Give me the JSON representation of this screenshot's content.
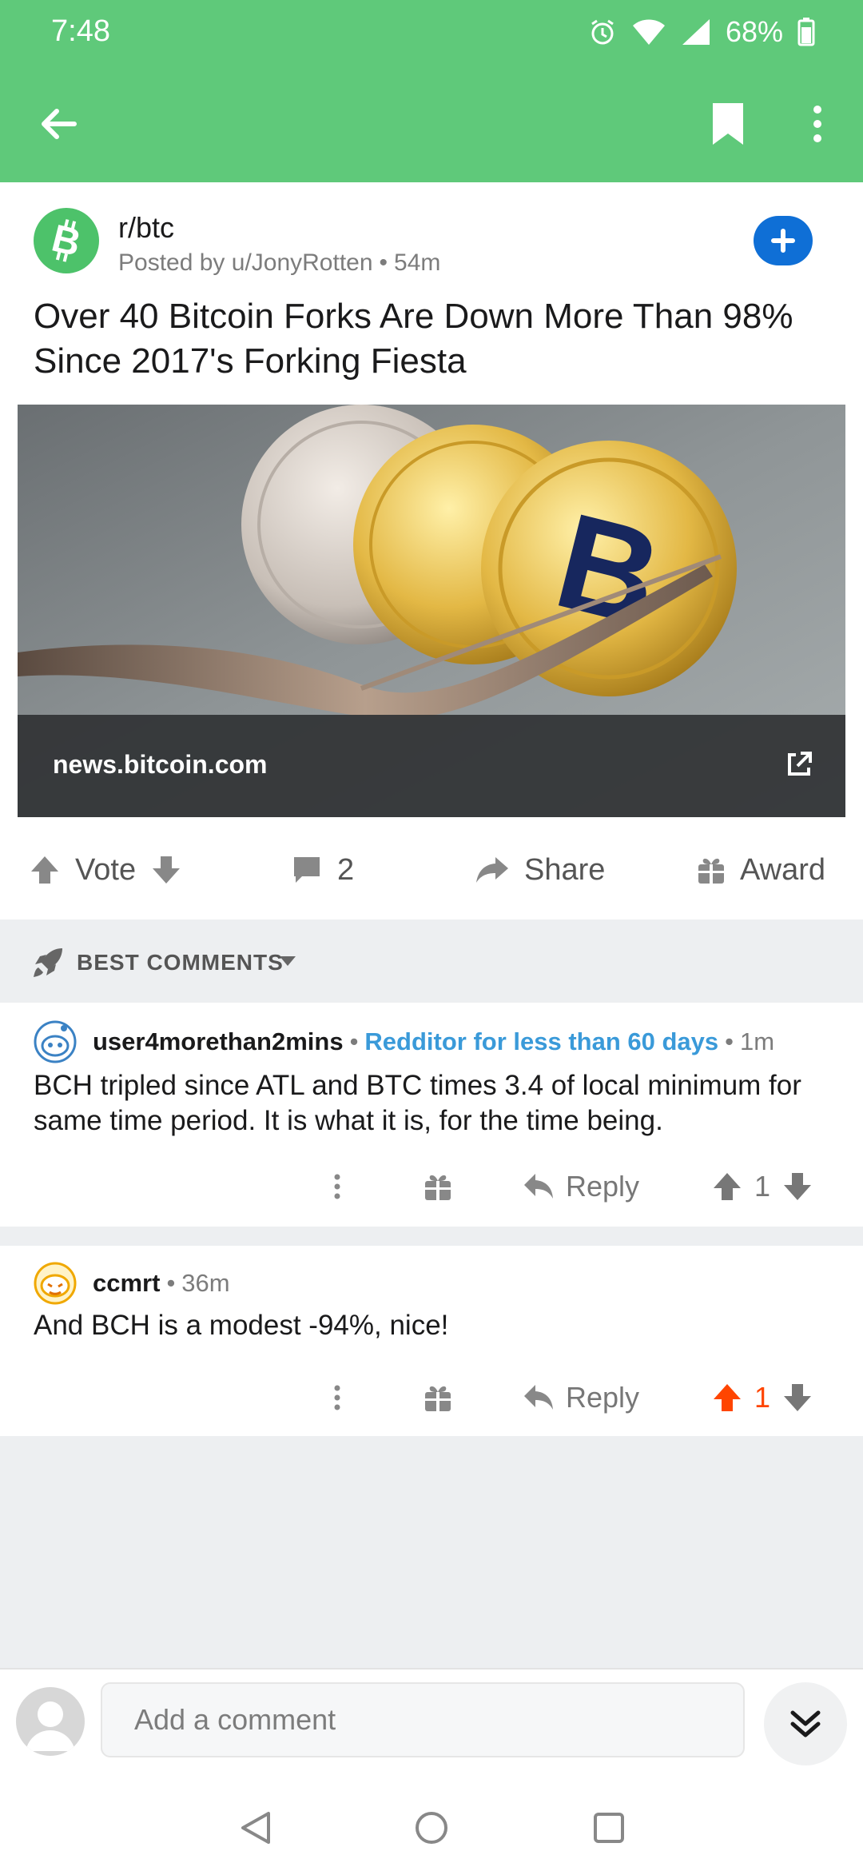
{
  "status_bar": {
    "time": "7:48",
    "battery": "68%"
  },
  "app_bar": {
    "back_icon": "arrow-left-icon",
    "save_icon": "bookmark-icon",
    "more_icon": "more-vertical-icon",
    "color": "#5fc97a"
  },
  "post": {
    "subreddit": "r/btc",
    "posted_by": "Posted by u/JonyRotten",
    "age": "54m",
    "title": "Over 40 Bitcoin Forks Are Down More Than 98% Since 2017's Forking Fiesta",
    "link_domain": "news.bitcoin.com",
    "image_alt": "Bitcoin coins resting on a fork"
  },
  "actions": {
    "vote": "Vote",
    "comments": "2",
    "share": "Share",
    "award": "Award"
  },
  "sort": {
    "label": "BEST COMMENTS"
  },
  "comments": [
    {
      "author": "user4morethan2mins",
      "flair": "Redditor for less than 60 days",
      "age": "1m",
      "body": "BCH tripled since ATL and BTC times 3.4 of local minimum for same time period.  It is what it is, for the time being.",
      "reply": "Reply",
      "score": "1",
      "upvoted": false
    },
    {
      "author": "ccmrt",
      "age": "36m",
      "body": "And BCH is a modest -94%, nice!",
      "reply": "Reply",
      "score": "1",
      "upvoted": true
    }
  ],
  "composer": {
    "placeholder": "Add a comment"
  },
  "colors": {
    "accent_green": "#5fc97a",
    "join_blue": "#0f6fd6",
    "upvote_orange": "#ff4500",
    "flair_blue": "#3a9ad9"
  }
}
